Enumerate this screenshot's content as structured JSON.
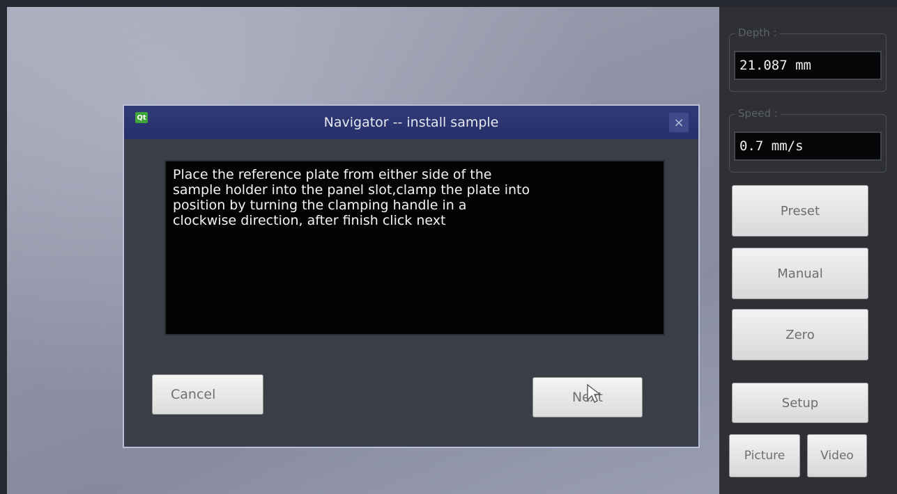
{
  "sidebar": {
    "depth": {
      "label": "Depth :",
      "value": "21.087 mm"
    },
    "speed": {
      "label": "Speed :",
      "value": "0.7 mm/s"
    },
    "buttons": {
      "preset": "Preset",
      "manual": "Manual",
      "zero": "Zero",
      "setup": "Setup",
      "picture": "Picture",
      "video": "Video"
    }
  },
  "dialog": {
    "icon_text": "Qt",
    "title": "Navigator -- install sample",
    "close_label": "×",
    "message": "Place the reference plate from either side of the\nsample holder into the panel slot,clamp the plate into\nposition by turning the clamping handle in a\nclockwise direction, after finish click next",
    "cancel_label": "Cancel",
    "next_label": "Next"
  },
  "icons": {
    "app": "qt-logo-icon",
    "close": "close-icon",
    "pointer": "mouse-cursor-icon"
  },
  "colors": {
    "titlebar": "#2a3470",
    "dialog_bg": "#3a3e47",
    "message_bg": "#040405",
    "sidebar_bg": "#2e3036"
  }
}
